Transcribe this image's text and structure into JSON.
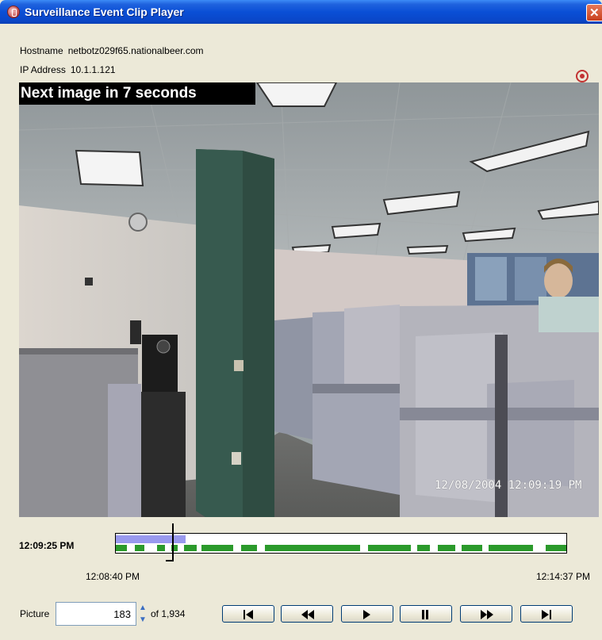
{
  "window": {
    "title": "Surveillance Event Clip Player"
  },
  "info": {
    "hostname_label": "Hostname",
    "hostname_value": "netbotz029f65.nationalbeer.com",
    "ip_label": "IP Address",
    "ip_value": "10.1.1.121"
  },
  "video": {
    "overlay_text": "Next image in 7 seconds",
    "timestamp": "12/08/2004 12:09:19 PM"
  },
  "timeline": {
    "current_time": "12:09:25 PM",
    "start_time": "12:08:40 PM",
    "end_time": "12:14:37 PM"
  },
  "picture": {
    "label": "Picture",
    "value": "183",
    "of_label": "of 1,934"
  },
  "controls": [
    {
      "name": "first-frame"
    },
    {
      "name": "rewind"
    },
    {
      "name": "play"
    },
    {
      "name": "pause"
    },
    {
      "name": "fast-forward"
    },
    {
      "name": "last-frame"
    }
  ],
  "colors": {
    "titlebar": "#0a4fd6",
    "timeline_range": "#9999ee",
    "timeline_events": "#2b9a2b",
    "record_icon": "#c23333"
  }
}
